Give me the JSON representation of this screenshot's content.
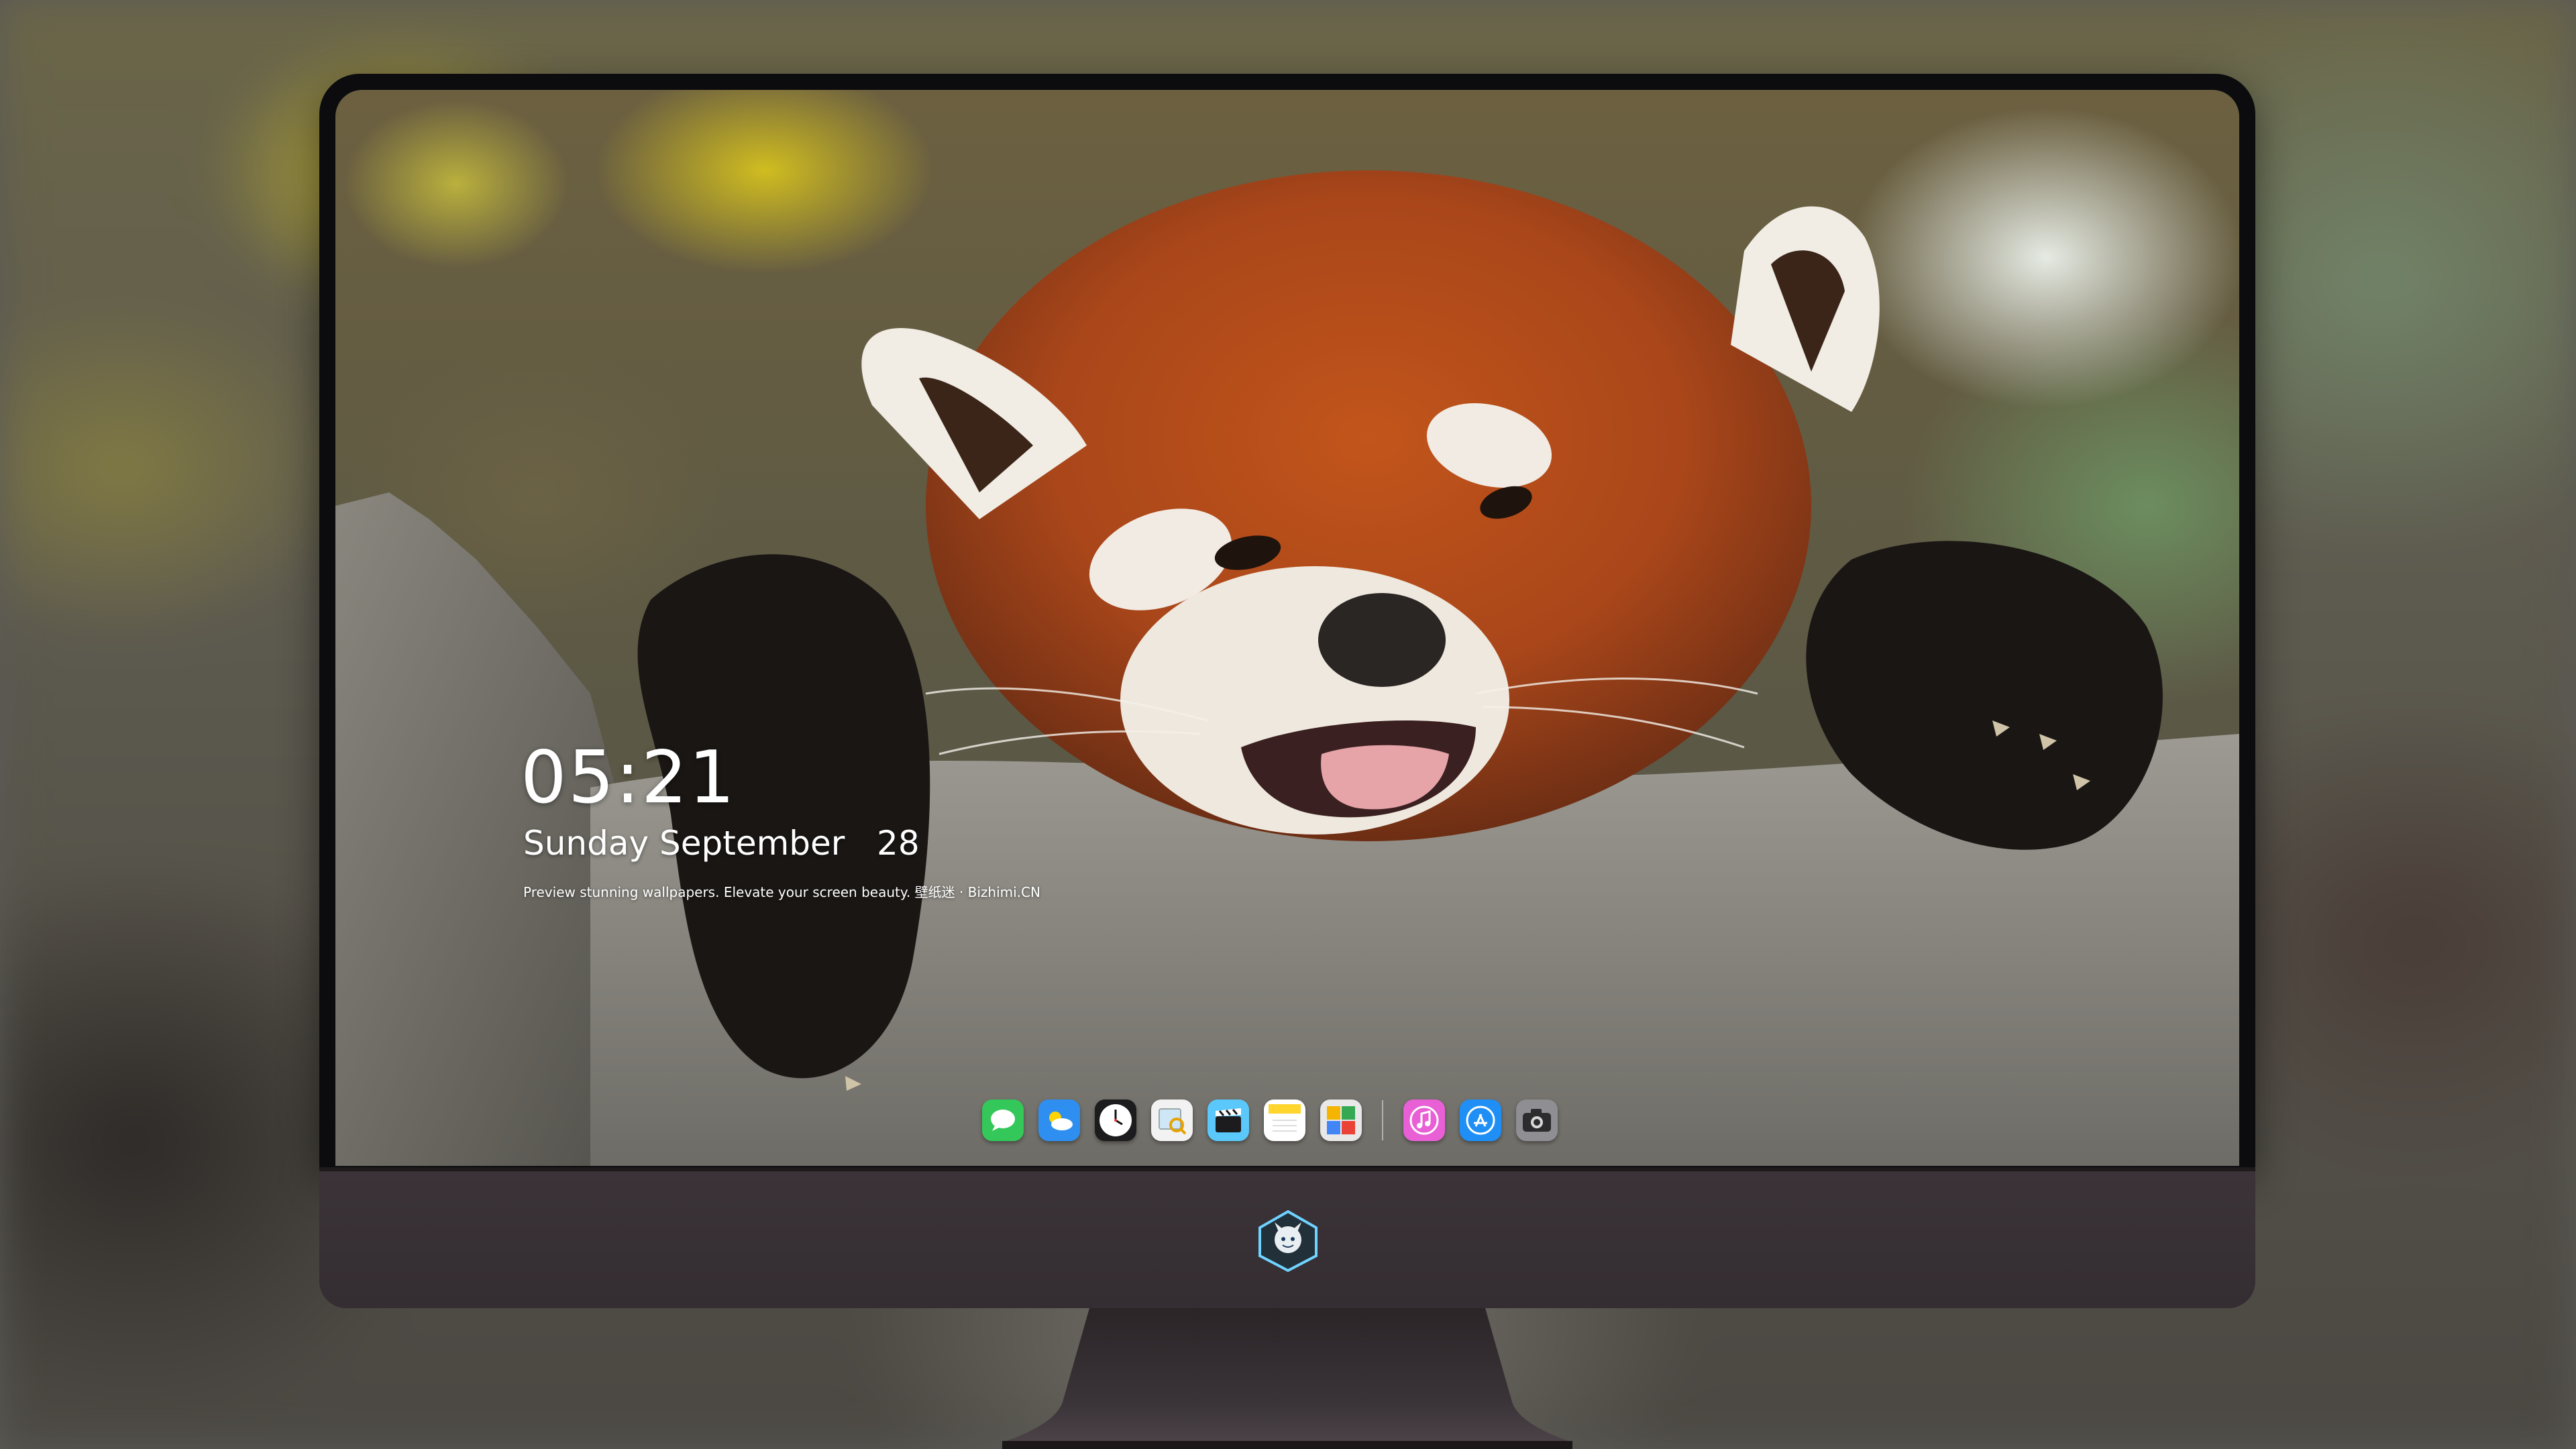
{
  "lockscreen": {
    "time": "05:21",
    "date": "Sunday September   28",
    "tagline": "Preview stunning wallpapers. Elevate your screen beauty. 壁纸迷 · Bizhimi.CN"
  },
  "dock": {
    "apps": [
      {
        "name": "Messages",
        "icon": "messages-icon",
        "color": "#34c759"
      },
      {
        "name": "Weather",
        "icon": "weather-icon",
        "color": "#2e8ff0"
      },
      {
        "name": "Clock",
        "icon": "clock-icon",
        "color": "#1c1c1e"
      },
      {
        "name": "Preview",
        "icon": "preview-icon",
        "color": "#f2f2f2"
      },
      {
        "name": "Clips",
        "icon": "clapperboard-icon",
        "color": "#5ac8fa"
      },
      {
        "name": "Notes",
        "icon": "notes-icon",
        "color": "#ffd52e"
      },
      {
        "name": "Photo Booth",
        "icon": "photo-grid-icon",
        "color": "#e8e8e8"
      },
      {
        "name": "iTunes",
        "icon": "music-note-icon",
        "color": "#e85fd6"
      },
      {
        "name": "App Store",
        "icon": "app-store-icon",
        "color": "#1f8ff5"
      },
      {
        "name": "Camera",
        "icon": "camera-icon",
        "color": "#8e8e93"
      }
    ]
  },
  "colors": {
    "text": "#ffffff",
    "bezel": "#0c0c0e",
    "chin": "#3b3337",
    "stand": "#2a2427"
  }
}
